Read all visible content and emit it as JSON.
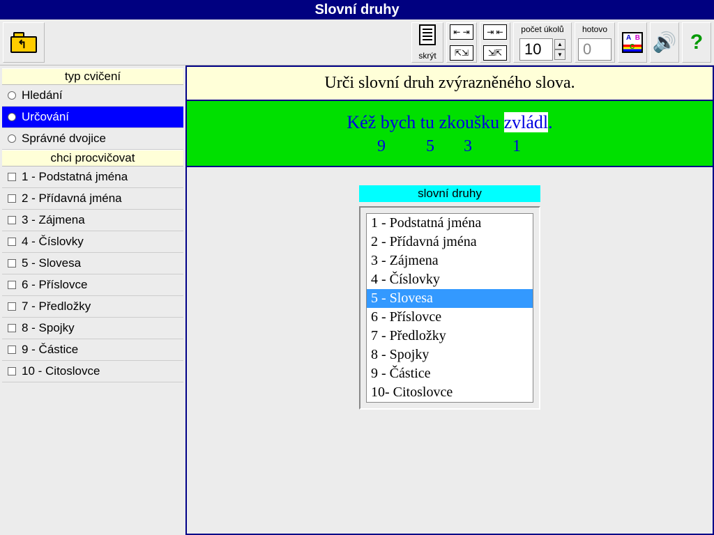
{
  "title": "Slovní druhy",
  "toolbar": {
    "skryt_label": "skrýt",
    "pocet_label": "počet úkolů",
    "pocet_value": "10",
    "hotovo_label": "hotovo",
    "hotovo_value": "0"
  },
  "sidebar": {
    "section1": "typ cvičení",
    "exercise_types": [
      {
        "label": "Hledání",
        "selected": false
      },
      {
        "label": "Určování",
        "selected": true
      },
      {
        "label": "Správné dvojice",
        "selected": false
      }
    ],
    "section2": "chci procvičovat",
    "practice": [
      "1 - Podstatná jména",
      "2 - Přídavná jména",
      "3 - Zájmena",
      "4 - Číslovky",
      "5 - Slovesa",
      "6 - Příslovce",
      "7 - Předložky",
      "8 - Spojky",
      "9 - Částice",
      "10 - Citoslovce"
    ]
  },
  "content": {
    "instruction": "Urči slovní druh zvýrazněného slova.",
    "sentence_pre": "Kéž bych tu zkoušku ",
    "sentence_hl": "zvládl",
    "sentence_post": ".",
    "nums": "9       5     3       1",
    "dropdown_title": "slovní druhy",
    "options": [
      {
        "label": "1 - Podstatná jména",
        "sel": false
      },
      {
        "label": "2 - Přídavná jména",
        "sel": false
      },
      {
        "label": "3 - Zájmena",
        "sel": false
      },
      {
        "label": "4 - Číslovky",
        "sel": false
      },
      {
        "label": "5 - Slovesa",
        "sel": true
      },
      {
        "label": "6 - Příslovce",
        "sel": false
      },
      {
        "label": "7 - Předložky",
        "sel": false
      },
      {
        "label": "8 - Spojky",
        "sel": false
      },
      {
        "label": "9 - Částice",
        "sel": false
      },
      {
        "label": "10- Citoslovce",
        "sel": false
      }
    ]
  }
}
